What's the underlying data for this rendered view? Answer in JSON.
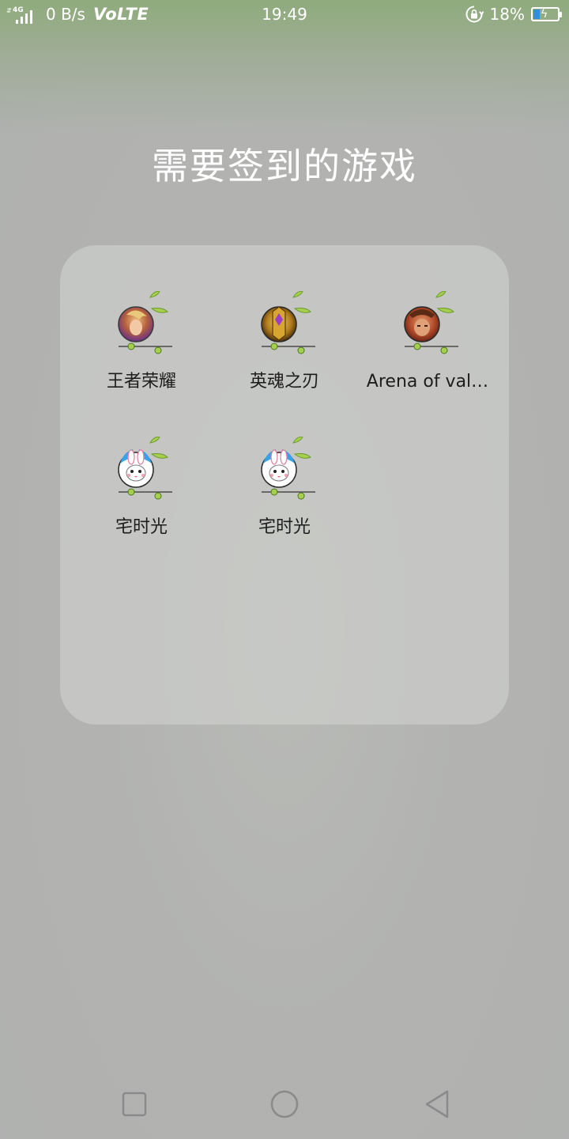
{
  "status_bar": {
    "network_type": "4G",
    "data_rate": "0 B/s",
    "volte": "VoLTE",
    "time": "19:49",
    "battery": "18%"
  },
  "page": {
    "title": "需要签到的游戏"
  },
  "apps": [
    {
      "label": "王者荣耀",
      "icon": "honor-of-kings-hero-icon"
    },
    {
      "label": "英魂之刃",
      "icon": "soul-blade-crest-icon"
    },
    {
      "label": "Arena of val…",
      "icon": "arena-of-valor-hero-icon"
    },
    {
      "label": "宅时光",
      "icon": "bunny-mascot-icon"
    },
    {
      "label": "宅时光",
      "icon": "bunny-mascot-icon"
    }
  ],
  "nav": {
    "recents": "recents-square-icon",
    "home": "home-circle-icon",
    "back": "back-triangle-icon"
  },
  "colors": {
    "sprout_green": "#8cc63f",
    "text_dark": "#1d1d1d",
    "battery_fill": "#2f8fe0"
  }
}
